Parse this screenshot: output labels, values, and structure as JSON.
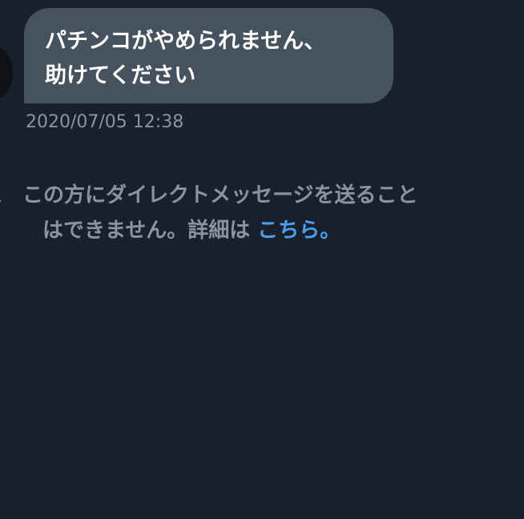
{
  "message": {
    "lines": [
      "パチンコがやめられません、",
      "助けてください"
    ],
    "timestamp": "2020/07/05 12:38"
  },
  "notice": {
    "leading_mark": "、",
    "line1": "この方にダイレクトメッセージを送ること",
    "line2_text": "はできません。詳細は ",
    "link_label": "こちら。"
  },
  "colors": {
    "background": "#1a202b",
    "bubble": "#47525f",
    "muted_text": "#8b949e",
    "link": "#4a9ff0"
  }
}
